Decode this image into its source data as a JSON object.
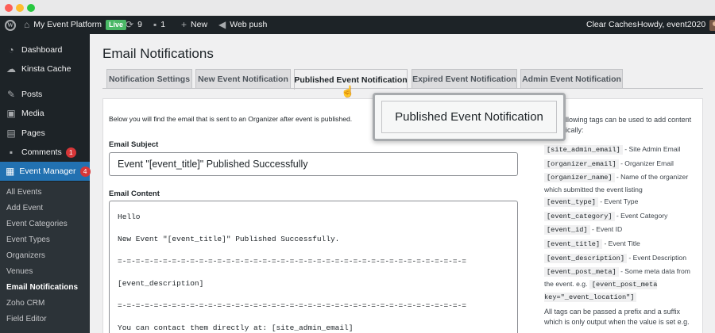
{
  "adminbar": {
    "site_name": "My Event Platform",
    "live_badge": "Live",
    "updates_count": "9",
    "comments_count": "1",
    "new_label": "New",
    "web_push_label": "Web push",
    "clear_caches_label": "Clear Caches",
    "howdy_label": "Howdy, event2020"
  },
  "sidebar": {
    "items": [
      {
        "label": "Dashboard",
        "icon": "dashboard-icon"
      },
      {
        "label": "Kinsta Cache",
        "icon": "cloud-icon"
      },
      {
        "label": "Posts",
        "icon": "pin-icon"
      },
      {
        "label": "Media",
        "icon": "media-icon"
      },
      {
        "label": "Pages",
        "icon": "pages-icon"
      },
      {
        "label": "Comments",
        "icon": "comment-icon",
        "badge": "1"
      },
      {
        "label": "Event Manager",
        "icon": "calendar-icon",
        "badge": "4"
      }
    ],
    "submenu": [
      "All Events",
      "Add Event",
      "Event Categories",
      "Event Types",
      "Organizers",
      "Venues",
      "Email Notifications",
      "Zoho CRM",
      "Field Editor"
    ]
  },
  "page": {
    "title": "Email Notifications",
    "tabs": [
      "Notification Settings",
      "New Event Notification",
      "Published Event Notification",
      "Expired Event Notification",
      "Admin Event Notification"
    ],
    "active_tab": "Published Event Notification",
    "intro": "Below you will find the email that is sent to an Organizer after event is published.",
    "subject_label": "Email Subject",
    "subject_value": "Event \"[event_title]\" Published Successfully",
    "content_label": "Email Content",
    "content_lines": [
      "Hello",
      "New Event \"[event_title]\" Published Successfully.",
      "=-=-=-=-=-=-=-=-=-=-=-=-=-=-=-=-=-=-=-=-=-=-=-=-=-=-=-=-=-=-=-=-=-=-=-=-=-=-=",
      "[event_description]",
      "=-=-=-=-=-=-=-=-=-=-=-=-=-=-=-=-=-=-=-=-=-=-=-=-=-=-=-=-=-=-=-=-=-=-=-=-=-=-=",
      "You can contact them directly at: [site_admin_email]"
    ]
  },
  "help": {
    "intro": "…llowing tags can be used to add content …ically:",
    "tags": [
      {
        "tag": "[site_admin_email]",
        "desc": "- Site Admin Email"
      },
      {
        "tag": "[organizer_email]",
        "desc": "- Organizer Email"
      },
      {
        "tag": "[organizer_name]",
        "desc": "- Name of the organizer which submitted the event listing"
      },
      {
        "tag": "[event_type]",
        "desc": "- Event Type"
      },
      {
        "tag": "[event_category]",
        "desc": "- Event Category"
      },
      {
        "tag": "[event_id]",
        "desc": "- Event ID"
      },
      {
        "tag": "[event_title]",
        "desc": "- Event Title"
      },
      {
        "tag": "[event_description]",
        "desc": "- Event Description"
      },
      {
        "tag": "[event_post_meta]",
        "desc": "- Some meta data from the event. e.g."
      },
      {
        "tag": "[event_post_meta key=\"_event_location\"]",
        "desc": ""
      }
    ],
    "footer": "All tags can be passed a prefix and a suffix which is only output when the value is set e.g."
  },
  "callout": {
    "label": "Published Event Notification"
  }
}
